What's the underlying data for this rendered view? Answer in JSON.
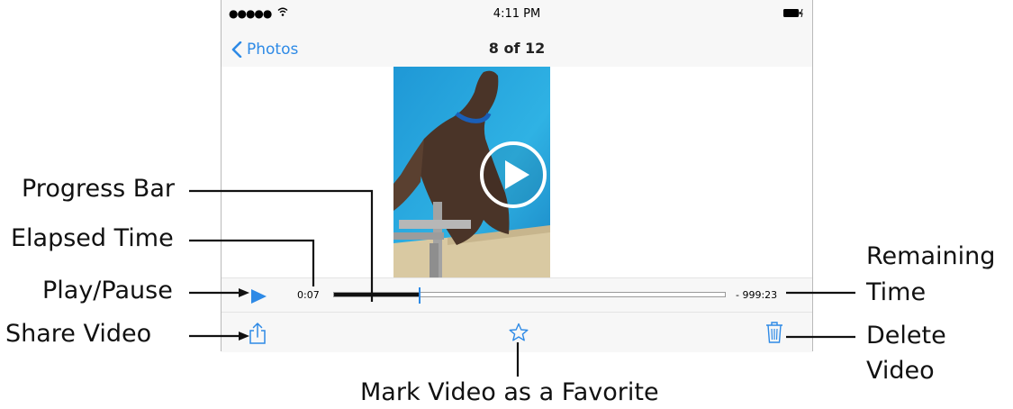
{
  "status_bar": {
    "signal": "●●●●●",
    "time": "4:11 PM"
  },
  "nav": {
    "back_label": "Photos",
    "title": "8 of 12"
  },
  "player": {
    "elapsed": "0:07",
    "remaining": "- 999:23",
    "progress_fraction": 0.22
  },
  "callouts": {
    "progress_bar": "Progress Bar",
    "elapsed_time": "Elapsed Time",
    "play_pause": "Play/Pause",
    "share_video": "Share Video",
    "remaining_time_line1": "Remaining",
    "remaining_time_line2": "Time",
    "delete_video_line1": "Delete",
    "delete_video_line2": "Video",
    "mark_favorite": "Mark Video as a Favorite"
  },
  "colors": {
    "accent": "#2e8ae6",
    "bar_bg": "#f7f7f7",
    "pool": "#29a3d8"
  },
  "icons": {
    "back": "chevron-left-icon",
    "play_overlay": "play-circle-icon",
    "play": "play-icon",
    "share": "share-icon",
    "favorite": "star-icon",
    "delete": "trash-icon",
    "wifi": "wifi-icon",
    "battery": "battery-icon"
  }
}
